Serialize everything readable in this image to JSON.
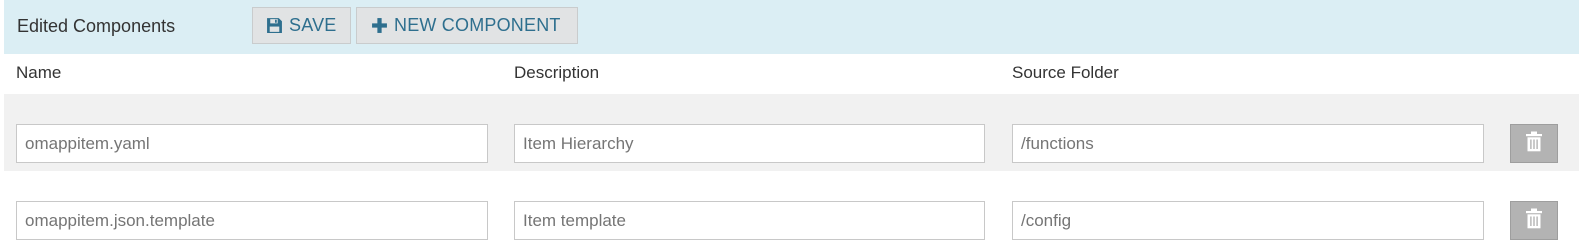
{
  "toolbar": {
    "title": "Edited Components",
    "save_label": "SAVE",
    "new_component_label": "NEW COMPONENT",
    "save_icon": "floppy-disk-icon",
    "new_icon": "plus-icon"
  },
  "columns": {
    "name": "Name",
    "description": "Description",
    "source_folder": "Source Folder"
  },
  "rows": [
    {
      "name": "omappitem.yaml",
      "description": "Item Hierarchy",
      "source_folder": "/functions",
      "delete_icon": "trash-icon"
    },
    {
      "name": "omappitem.json.template",
      "description": "Item template",
      "source_folder": "/config",
      "delete_icon": "trash-icon"
    }
  ],
  "colors": {
    "toolbar_bg": "#dbeef4",
    "accent": "#2e6f8e",
    "row_alt_bg": "#f1f1f1",
    "delete_bg": "#b3b3b3"
  }
}
